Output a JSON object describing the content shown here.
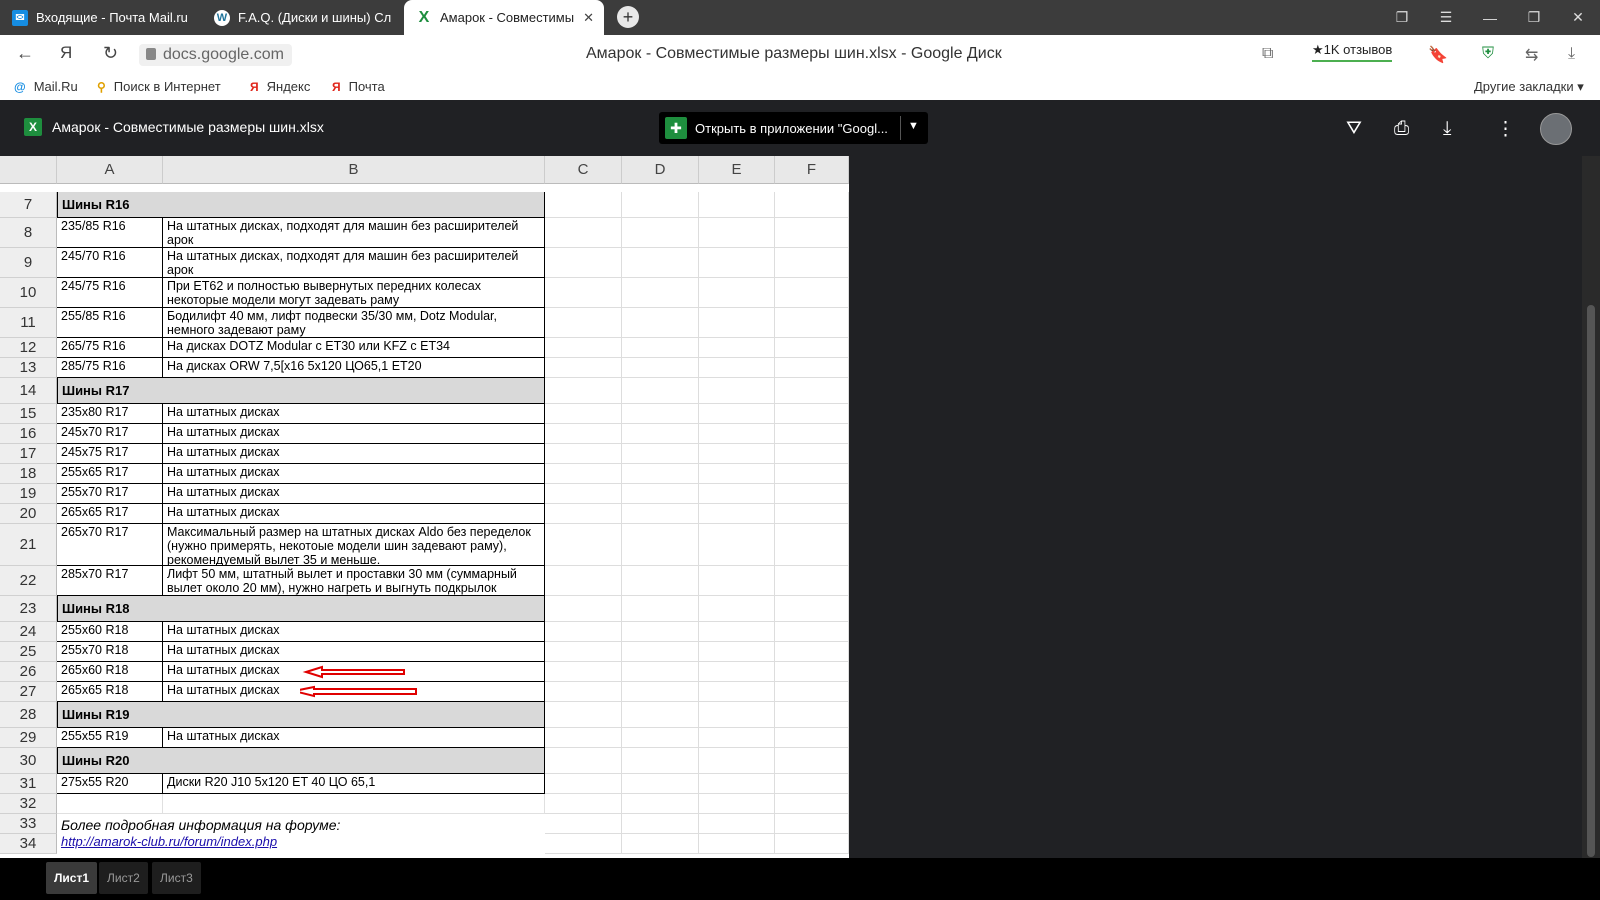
{
  "browser": {
    "tabs": [
      {
        "title": "Входящие - Почта Mail.ru",
        "icon": "mail-icon"
      },
      {
        "title": "F.A.Q. (Диски и шины) Сл",
        "icon": "wordpress-icon"
      },
      {
        "title": "Амарок - Совместимы",
        "icon": "excel-icon"
      }
    ],
    "url": "docs.google.com",
    "page_title": "Амарок - Совместимые размеры шин.xlsx - Google Диск",
    "reviews": "★1K отзывов",
    "bookmarks": [
      "Mail.Ru",
      "Поиск в Интернет",
      "Яндекс",
      "Почта"
    ],
    "other_bookmarks": "Другие закладки ▾"
  },
  "drive": {
    "file_title": "Амарок - Совместимые размеры шин.xlsx",
    "open_button": "Открыть в приложении \"Googl..."
  },
  "sheet": {
    "columns": [
      "A",
      "B",
      "C",
      "D",
      "E",
      "F"
    ],
    "rows": [
      {
        "n": "7",
        "section": "Шины R16"
      },
      {
        "n": "8",
        "a": "235/85 R16",
        "b": "На штатных дисках, подходят для машин без расширителей арок"
      },
      {
        "n": "9",
        "a": "245/70 R16",
        "b": "На штатных дисках, подходят для машин без расширителей арок"
      },
      {
        "n": "10",
        "a": "245/75 R16",
        "b": "При ET62 и полностью вывернутых передних колесах некоторые модели могут задевать раму"
      },
      {
        "n": "11",
        "a": "255/85 R16",
        "b": "Бодилифт 40 мм, лифт подвески 35/30 мм, Dotz Modular, немного задевают раму"
      },
      {
        "n": "12",
        "a": "265/75 R16",
        "b": "На дисках DOTZ Modular с ET30 или KFZ с ET34"
      },
      {
        "n": "13",
        "a": "285/75 R16",
        "b": "На дисках ORW 7,5[x16 5x120 ЦО65,1 ET20"
      },
      {
        "n": "14",
        "section": "Шины R17"
      },
      {
        "n": "15",
        "a": "235x80 R17",
        "b": "На штатных дисках"
      },
      {
        "n": "16",
        "a": "245x70 R17",
        "b": "На штатных дисках"
      },
      {
        "n": "17",
        "a": "245x75 R17",
        "b": "На штатных дисках"
      },
      {
        "n": "18",
        "a": "255x65 R17",
        "b": "На штатных дисках"
      },
      {
        "n": "19",
        "a": "255x70 R17",
        "b": "На штатных дисках"
      },
      {
        "n": "20",
        "a": "265x65 R17",
        "b": "На штатных дисках"
      },
      {
        "n": "21",
        "a": "265x70 R17",
        "b": "Максимальный размер на штатных дисках Aldo без переделок (нужно примерять, некотоые модели шин задевают раму), рекомендуемый вылет 35 и меньше."
      },
      {
        "n": "22",
        "a": "285x70 R17",
        "b": "Лифт 50 мм, штатный вылет и проставки 30 мм (суммарный вылет около 20 мм), нужно нагреть и выгнуть подкрылок"
      },
      {
        "n": "23",
        "section": "Шины R18"
      },
      {
        "n": "24",
        "a": "255x60 R18",
        "b": "На штатных дисках"
      },
      {
        "n": "25",
        "a": "255x70 R18",
        "b": "На штатных дисках"
      },
      {
        "n": "26",
        "a": "265x60 R18",
        "b": "На штатных дисках"
      },
      {
        "n": "27",
        "a": "265x65 R18",
        "b": "На штатных дисках"
      },
      {
        "n": "28",
        "section": "Шины R19"
      },
      {
        "n": "29",
        "a": "255x55 R19",
        "b": "На штатных дисках"
      },
      {
        "n": "30",
        "section": "Шины R20"
      },
      {
        "n": "31",
        "a": "275x55 R20",
        "b": "Диски R20 J10 5x120 ET 40 ЦО 65,1"
      },
      {
        "n": "32"
      },
      {
        "n": "33",
        "note": "Более подробная информация на форуме:"
      },
      {
        "n": "34",
        "link": "http://amarok-club.ru/forum/index.php"
      }
    ]
  },
  "sheet_tabs": [
    "Лист1",
    "Лист2",
    "Лист3"
  ]
}
